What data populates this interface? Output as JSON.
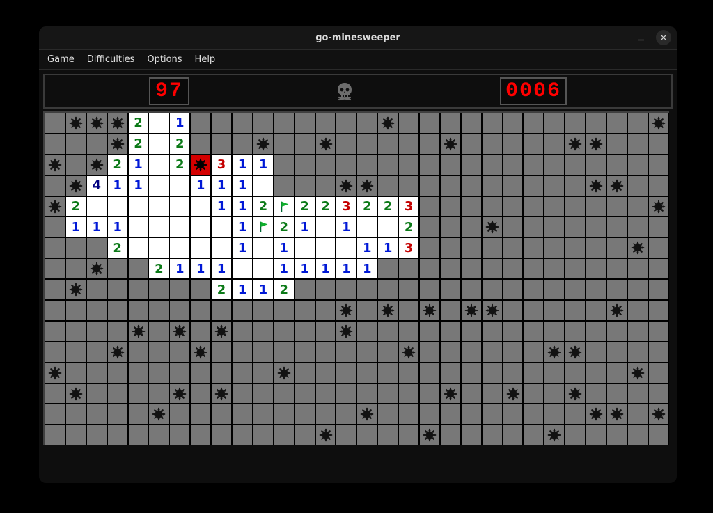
{
  "title": "go-minesweeper",
  "menu": {
    "items": [
      "Game",
      "Difficulties",
      "Options",
      "Help"
    ]
  },
  "status": {
    "mines": "97",
    "time": "0006",
    "face": "dead"
  },
  "board": {
    "rows": 16,
    "cols": 30,
    "cells": [
      [
        "c",
        "m",
        "m",
        "m",
        "r2",
        "r",
        "r1",
        "c",
        "c",
        "c",
        "c",
        "c",
        "c",
        "c",
        "c",
        "c",
        "m",
        "c",
        "c",
        "c",
        "c",
        "c",
        "c",
        "c",
        "c",
        "c",
        "c",
        "c",
        "c",
        "m"
      ],
      [
        "c",
        "c",
        "c",
        "m",
        "r2",
        "r",
        "r2",
        "c",
        "c",
        "c",
        "m",
        "c",
        "c",
        "m",
        "c",
        "c",
        "c",
        "c",
        "c",
        "m",
        "c",
        "c",
        "c",
        "c",
        "c",
        "m",
        "m",
        "c",
        "c",
        "c"
      ],
      [
        "m",
        "c",
        "m",
        "r2",
        "r1",
        "r",
        "r2",
        "x",
        "r3",
        "r1",
        "r1",
        "c",
        "c",
        "c",
        "c",
        "c",
        "c",
        "c",
        "c",
        "c",
        "c",
        "c",
        "c",
        "c",
        "c",
        "c",
        "c",
        "c",
        "c",
        "c"
      ],
      [
        "c",
        "m",
        "r4",
        "r1",
        "r1",
        "r",
        "r",
        "r1",
        "r1",
        "r1",
        "r",
        "c",
        "c",
        "c",
        "m",
        "m",
        "c",
        "c",
        "c",
        "c",
        "c",
        "c",
        "c",
        "c",
        "c",
        "c",
        "m",
        "m",
        "c",
        "c"
      ],
      [
        "m",
        "r2",
        "r",
        "r",
        "r",
        "r",
        "r",
        "r",
        "r1",
        "r1",
        "r2",
        "f",
        "r2",
        "r2",
        "r3",
        "r2",
        "r2",
        "r3",
        "c",
        "c",
        "c",
        "c",
        "c",
        "c",
        "c",
        "c",
        "c",
        "c",
        "c",
        "m"
      ],
      [
        "c",
        "r1",
        "r1",
        "r1",
        "r",
        "r",
        "r",
        "r",
        "r",
        "r1",
        "f",
        "r2",
        "r1",
        "r",
        "r1",
        "r",
        "r",
        "r2",
        "c",
        "c",
        "c",
        "m",
        "c",
        "c",
        "c",
        "c",
        "c",
        "c",
        "c",
        "c"
      ],
      [
        "c",
        "c",
        "c",
        "r2",
        "r",
        "r",
        "r",
        "r",
        "r",
        "r1",
        "r",
        "r1",
        "r",
        "r",
        "r",
        "r1",
        "r1",
        "r3",
        "c",
        "c",
        "c",
        "c",
        "c",
        "c",
        "c",
        "c",
        "c",
        "c",
        "m",
        "c"
      ],
      [
        "c",
        "c",
        "m",
        "c",
        "c",
        "r2",
        "r1",
        "r1",
        "r1",
        "r",
        "r",
        "r1",
        "r1",
        "r1",
        "r1",
        "r1",
        "c",
        "c",
        "c",
        "c",
        "c",
        "c",
        "c",
        "c",
        "c",
        "c",
        "c",
        "c",
        "c",
        "c"
      ],
      [
        "c",
        "m",
        "c",
        "c",
        "c",
        "c",
        "c",
        "c",
        "r2",
        "r1",
        "r1",
        "r2",
        "c",
        "c",
        "c",
        "c",
        "c",
        "c",
        "c",
        "c",
        "c",
        "c",
        "c",
        "c",
        "c",
        "c",
        "c",
        "c",
        "c",
        "c"
      ],
      [
        "c",
        "c",
        "c",
        "c",
        "c",
        "c",
        "c",
        "c",
        "c",
        "c",
        "c",
        "c",
        "c",
        "c",
        "m",
        "c",
        "m",
        "c",
        "m",
        "c",
        "m",
        "m",
        "c",
        "c",
        "c",
        "c",
        "c",
        "m",
        "c",
        "c"
      ],
      [
        "c",
        "c",
        "c",
        "c",
        "m",
        "c",
        "m",
        "c",
        "m",
        "c",
        "c",
        "c",
        "c",
        "c",
        "m",
        "c",
        "c",
        "c",
        "c",
        "c",
        "c",
        "c",
        "c",
        "c",
        "c",
        "c",
        "c",
        "c",
        "c",
        "c"
      ],
      [
        "c",
        "c",
        "c",
        "m",
        "c",
        "c",
        "c",
        "m",
        "c",
        "c",
        "c",
        "c",
        "c",
        "c",
        "c",
        "c",
        "c",
        "m",
        "c",
        "c",
        "c",
        "c",
        "c",
        "c",
        "m",
        "m",
        "c",
        "c",
        "c",
        "c"
      ],
      [
        "m",
        "c",
        "c",
        "c",
        "c",
        "c",
        "c",
        "c",
        "c",
        "c",
        "c",
        "m",
        "c",
        "c",
        "c",
        "c",
        "c",
        "c",
        "c",
        "c",
        "c",
        "c",
        "c",
        "c",
        "c",
        "c",
        "c",
        "c",
        "m",
        "c"
      ],
      [
        "c",
        "m",
        "c",
        "c",
        "c",
        "c",
        "m",
        "c",
        "m",
        "c",
        "c",
        "c",
        "c",
        "c",
        "c",
        "c",
        "c",
        "c",
        "c",
        "m",
        "c",
        "c",
        "m",
        "c",
        "c",
        "m",
        "c",
        "c",
        "c",
        "c"
      ],
      [
        "c",
        "c",
        "c",
        "c",
        "c",
        "m",
        "c",
        "c",
        "c",
        "c",
        "c",
        "c",
        "c",
        "c",
        "c",
        "m",
        "c",
        "c",
        "c",
        "c",
        "c",
        "c",
        "c",
        "c",
        "c",
        "c",
        "m",
        "m",
        "c",
        "m"
      ],
      [
        "c",
        "c",
        "c",
        "c",
        "c",
        "c",
        "c",
        "c",
        "c",
        "c",
        "c",
        "c",
        "c",
        "m",
        "c",
        "c",
        "c",
        "c",
        "m",
        "c",
        "c",
        "c",
        "c",
        "c",
        "m",
        "c",
        "c",
        "c",
        "c",
        "c"
      ]
    ]
  }
}
